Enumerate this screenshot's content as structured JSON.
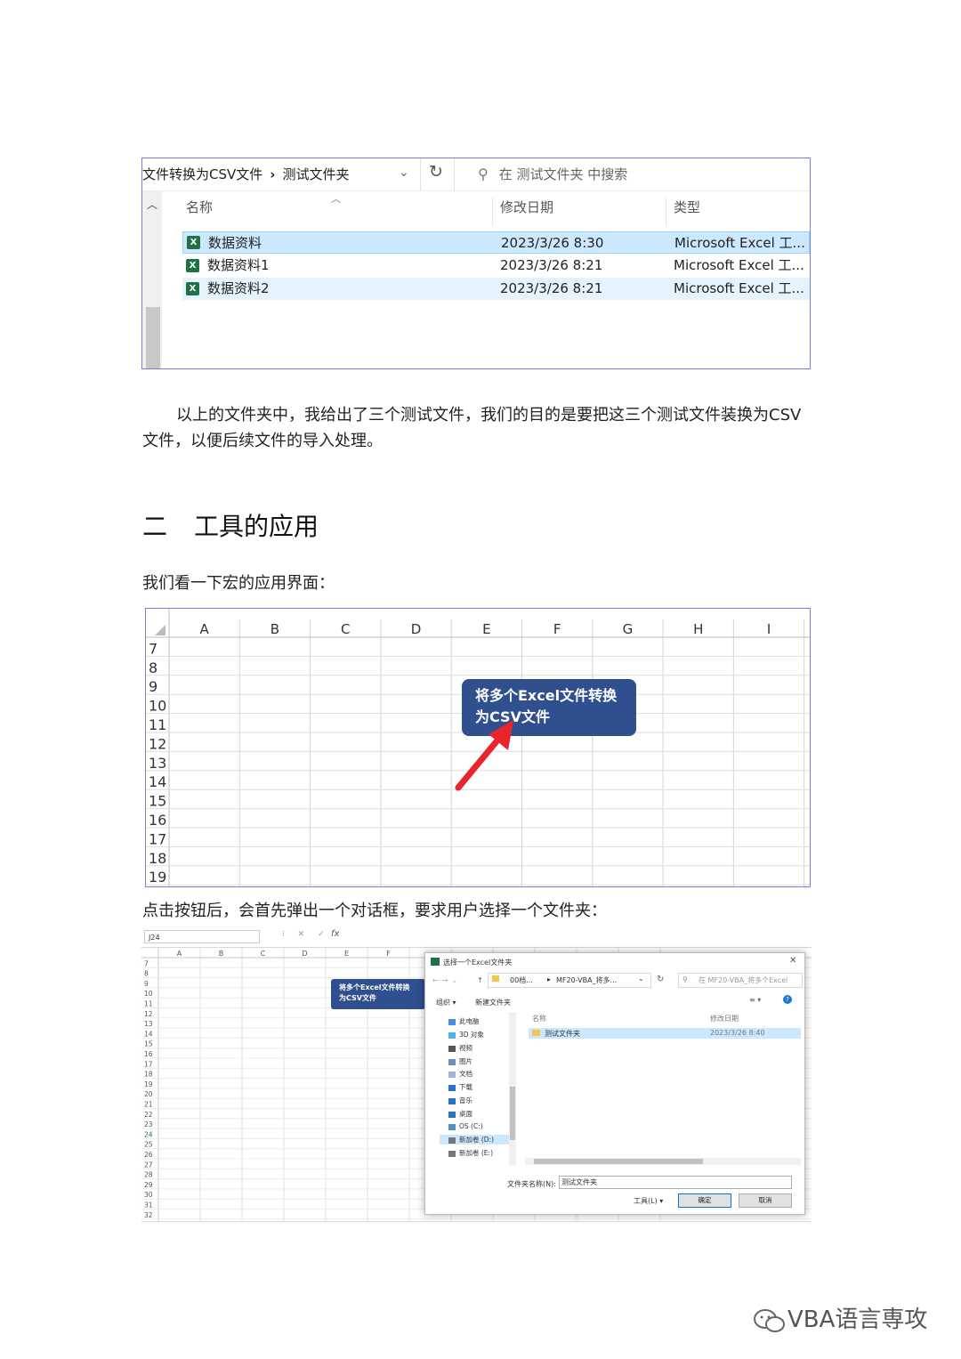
{
  "explorer": {
    "breadcrumb": [
      "文件转换为CSV文件",
      "测试文件夹"
    ],
    "search_placeholder": "在 测试文件夹 中搜索",
    "columns": {
      "name": "名称",
      "modified": "修改日期",
      "type": "类型"
    },
    "files": [
      {
        "icon": "excel-file-icon",
        "name": "数据资料",
        "modified": "2023/3/26 8:30",
        "type": "Microsoft Excel 工...",
        "state": "selected"
      },
      {
        "icon": "excel-file-icon",
        "name": "数据资料1",
        "modified": "2023/3/26 8:21",
        "type": "Microsoft Excel 工..."
      },
      {
        "icon": "excel-file-icon",
        "name": "数据资料2",
        "modified": "2023/3/26 8:21",
        "type": "Microsoft Excel 工...",
        "state": "hover"
      }
    ]
  },
  "paragraph1": "以上的文件夹中，我给出了三个测试文件，我们的目的是要把这三个测试文件装换为CSV 文件，以便后续文件的导入处理。",
  "section_heading": {
    "number": "二",
    "title": "工具的应用"
  },
  "paragraph2": "我们看一下宏的应用界面：",
  "sheet": {
    "columns": [
      "A",
      "B",
      "C",
      "D",
      "E",
      "F",
      "G",
      "H",
      "I"
    ],
    "rows": [
      "7",
      "8",
      "9",
      "10",
      "11",
      "12",
      "13",
      "14",
      "15",
      "16",
      "17",
      "18",
      "19"
    ],
    "button_label": [
      "将多个Excel文件转换",
      "为CSV文件"
    ],
    "arrow_color": "#e8242c",
    "button_color": "#2f4f8f"
  },
  "paragraph3": "点击按钮后，会首先弹出一个对话框，要求用户选择一个文件夹：",
  "dialog_shot": {
    "namebox": "J24",
    "sheet_columns": [
      "A",
      "B",
      "C",
      "D",
      "E",
      "F"
    ],
    "sheet_rows": [
      "7",
      "8",
      "9",
      "10",
      "11",
      "12",
      "13",
      "14",
      "15",
      "16",
      "17",
      "18",
      "19",
      "20",
      "21",
      "22",
      "23",
      "24",
      "25",
      "26",
      "27",
      "28",
      "29",
      "30",
      "31",
      "32"
    ],
    "button_label": [
      "将多个Excel文件转换",
      "为CSV文件"
    ],
    "title": "选择一个Excel文件夹",
    "path": [
      "00档...",
      "MF20-VBA_将多..."
    ],
    "search_placeholder": "在 MF20-VBA_将多个Excel",
    "organize": "组织 ▾",
    "new_folder": "新建文件夹",
    "nav_items": [
      "此电脑",
      "3D 对象",
      "视频",
      "图片",
      "文档",
      "下载",
      "音乐",
      "桌面",
      "OS (C:)",
      "新加卷 (D:)",
      "新加卷 (E:)"
    ],
    "list_headers": {
      "name": "名称",
      "modified": "修改日期"
    },
    "folder": {
      "name": "测试文件夹",
      "modified": "2023/3/26 8:40"
    },
    "folder_name_label": "文件夹名称(N):",
    "folder_name_value": "测试文件夹",
    "tools": "工具(L)",
    "ok": "确定",
    "cancel": "取消"
  },
  "watermark": "VBA语言専攻"
}
